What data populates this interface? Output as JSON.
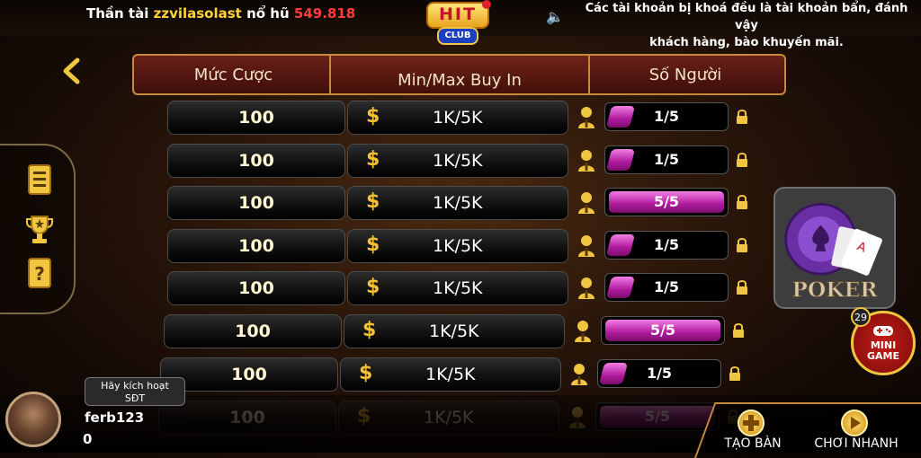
{
  "top_bar": {
    "jackpot_prefix": "Thần tài",
    "jackpot_user": "zzvilasolast",
    "jackpot_middle": "nổ hũ",
    "jackpot_amount": "549.818",
    "notice_line1": "Các tài khoản bị khoá đều là tài khoản bẩn, đánh vậy",
    "notice_line2": "khách hàng, bào khuyến mãi."
  },
  "logo": {
    "main": "HIT",
    "sub": "CLUB"
  },
  "table_header": {
    "col_bet": "Mức Cược",
    "col_buyin": "Min/Max Buy In",
    "col_players": "Số Người"
  },
  "rows": [
    {
      "bet": "100",
      "buyin": "1K/5K",
      "players": "1/5",
      "fill": 0.2
    },
    {
      "bet": "100",
      "buyin": "1K/5K",
      "players": "1/5",
      "fill": 0.2
    },
    {
      "bet": "100",
      "buyin": "1K/5K",
      "players": "5/5",
      "fill": 1.0
    },
    {
      "bet": "100",
      "buyin": "1K/5K",
      "players": "1/5",
      "fill": 0.2
    },
    {
      "bet": "100",
      "buyin": "1K/5K",
      "players": "1/5",
      "fill": 0.2
    },
    {
      "bet": "100",
      "buyin": "1K/5K",
      "players": "5/5",
      "fill": 1.0
    },
    {
      "bet": "100",
      "buyin": "1K/5K",
      "players": "1/5",
      "fill": 0.2
    },
    {
      "bet": "100",
      "buyin": "1K/5K",
      "players": "5/5",
      "fill": 1.0
    }
  ],
  "right_panel": {
    "poker_label": "POKER",
    "mini_game_label_1": "MINI",
    "mini_game_label_2": "GAME",
    "mini_game_badge": "29"
  },
  "user": {
    "activate_line1": "Hãy kích hoạt",
    "activate_line2": "SĐT",
    "username": "ferb123",
    "balance": "0"
  },
  "bottom_buttons": {
    "create_table": "TẠO BÀN",
    "quick_play": "CHƠI NHANH"
  },
  "colors": {
    "accent_gold": "#f5c132",
    "players_fill": "#c42ab0",
    "jackpot_amount": "#ff3b3b",
    "header_bg": "#5a1812"
  }
}
